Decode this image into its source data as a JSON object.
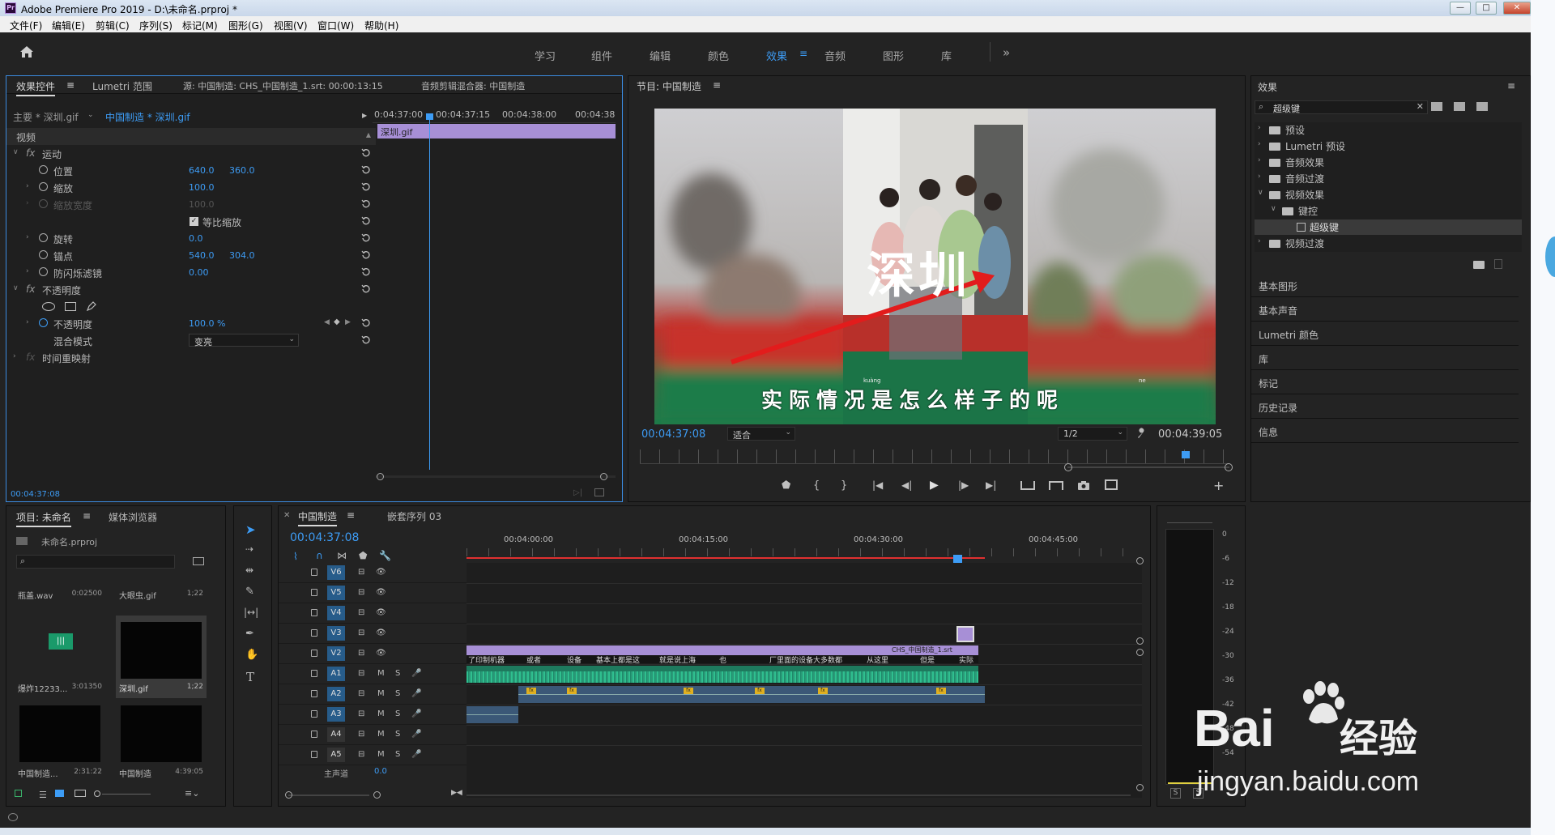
{
  "window": {
    "title": "Adobe Premiere Pro 2019 - D:\\未命名.prproj *",
    "app_badge": "Pr",
    "controls": {
      "minimize": "—",
      "maximize": "□",
      "close": "✕"
    }
  },
  "menu": [
    "文件(F)",
    "编辑(E)",
    "剪辑(C)",
    "序列(S)",
    "标记(M)",
    "图形(G)",
    "视图(V)",
    "窗口(W)",
    "帮助(H)"
  ],
  "workspaces": {
    "tabs": [
      "学习",
      "组件",
      "编辑",
      "颜色",
      "效果",
      "音频",
      "图形",
      "库"
    ],
    "active": "效果",
    "more": "»"
  },
  "effect_controls": {
    "tabs": [
      "效果控件",
      "Lumetri 范围",
      "源: 中国制造: CHS_中国制造_1.srt: 00:00:13:15",
      "音频剪辑混合器: 中国制造"
    ],
    "master": "主要 * 深圳.gif",
    "sequence_clip": "中国制造 * 深圳.gif",
    "timecodes": [
      "0:04:37:00",
      "00:04:37:15",
      "00:04:38:00",
      "00:04:38"
    ],
    "clip_label": "深圳.gif",
    "section_video": "视频",
    "motion": "运动",
    "position_label": "位置",
    "position_x": "640.0",
    "position_y": "360.0",
    "scale_label": "缩放",
    "scale": "100.0",
    "scale_width_label": "缩放宽度",
    "scale_width": "100.0",
    "uniform_label": "等比缩放",
    "rotation_label": "旋转",
    "rotation": "0.0",
    "anchor_label": "锚点",
    "anchor_x": "540.0",
    "anchor_y": "304.0",
    "antiflicker_label": "防闪烁滤镜",
    "antiflicker": "0.00",
    "opacity_section": "不透明度",
    "opacity_label": "不透明度",
    "opacity": "100.0 %",
    "blend_label": "混合模式",
    "blend": "变亮",
    "time_remap": "时间重映射",
    "footer_tc": "00:04:37:08",
    "fx_badge": "fx"
  },
  "program": {
    "title": "节目: 中国制造",
    "timecode": "00:04:37:08",
    "fit": "适合",
    "resolution": "1/2",
    "duration": "00:04:39:05",
    "overlay_title": "深圳",
    "subtitle": "实际情况是怎么样子的呢",
    "ruby": [
      "kuàng",
      "ne"
    ]
  },
  "effects_panel": {
    "title": "效果",
    "search": "超级键",
    "tree": [
      "预设",
      "Lumetri 预设",
      "音频效果",
      "音频过渡",
      "视频效果",
      "键控",
      "超级键",
      "视频过渡"
    ],
    "sections": [
      "基本图形",
      "基本声音",
      "Lumetri 颜色",
      "库",
      "标记",
      "历史记录",
      "信息"
    ]
  },
  "project": {
    "tabs": [
      "项目: 未命名",
      "媒体浏览器"
    ],
    "file": "未命名.prproj",
    "items": [
      {
        "name": "瓶盖.wav",
        "dur": "0:02500"
      },
      {
        "name": "大眼虫.gif",
        "dur": "1;22"
      },
      {
        "name": "爆炸12233...",
        "dur": "3:01350"
      },
      {
        "name": "深圳.gif",
        "dur": "1;22"
      },
      {
        "name": "中国制造...",
        "dur": "2:31:22"
      },
      {
        "name": "中国制造",
        "dur": "4:39:05"
      }
    ]
  },
  "timeline": {
    "tabs": [
      "中国制造",
      "嵌套序列 03"
    ],
    "timecode": "00:04:37:08",
    "ruler": [
      "00:04:00:00",
      "00:04:15:00",
      "00:04:30:00",
      "00:04:45:00"
    ],
    "video_tracks": [
      "V6",
      "V5",
      "V4",
      "V3",
      "V2"
    ],
    "audio_tracks": [
      "A1",
      "A2",
      "A3",
      "A4",
      "A5"
    ],
    "master": "主声道",
    "master_value": "0.0",
    "caption_texts": [
      "了印制机器",
      "或者",
      "设备",
      "基本上都是这",
      "就是说上海",
      "也",
      "厂里面的设备大多数都",
      "从这里",
      "但是",
      "实际"
    ],
    "v2_clip": "CHS_中国制造_1.srt",
    "fx_label": "fx",
    "track_m": "M",
    "track_s": "S"
  },
  "meters": {
    "scale": [
      "0",
      "-6",
      "-12",
      "-18",
      "-24",
      "-30",
      "-36",
      "-42",
      "-48",
      "-54"
    ],
    "solo": "S"
  },
  "watermark": {
    "line1": "Bai",
    "line2": "经验",
    "url": "jingyan.baidu.com"
  },
  "colors": {
    "accent": "#3d9cf5",
    "clip_purple": "#a78fd6",
    "audio_green": "#2fbf8f",
    "playhead": "#3d9cf5",
    "work_area": "#e03030"
  }
}
